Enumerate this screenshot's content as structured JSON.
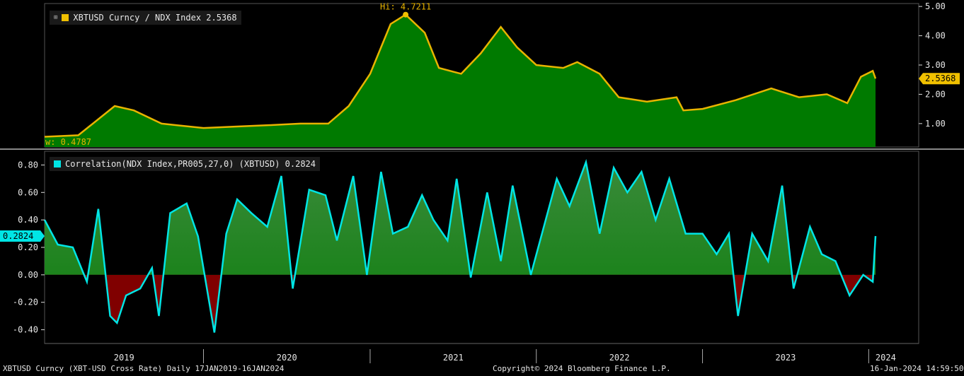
{
  "chart_data": [
    {
      "type": "area",
      "legend": "XBTUSD Curncy / NDX Index 2.5368",
      "last_value": "2.5368",
      "high_label": "Hi: 4.7211",
      "low_label": "w: 0.4787",
      "high": 4.7211,
      "low": 0.4787,
      "ylim": [
        0.2,
        5.1
      ],
      "yticks": [
        1.0,
        2.0,
        3.0,
        4.0,
        5.0
      ],
      "ytick_labels": [
        "1.00",
        "2.00",
        "3.00",
        "4.00",
        "5.00"
      ],
      "colors": {
        "line": "#e8b400",
        "fill": "#007a00",
        "tag": "#f0c000"
      },
      "x": [
        "2019-01-17",
        "2019-04-01",
        "2019-06-20",
        "2019-08-01",
        "2019-10-01",
        "2020-01-01",
        "2020-03-15",
        "2020-06-01",
        "2020-08-01",
        "2020-10-01",
        "2020-11-15",
        "2021-01-01",
        "2021-02-15",
        "2021-03-20",
        "2021-05-01",
        "2021-06-01",
        "2021-07-20",
        "2021-09-01",
        "2021-10-15",
        "2021-11-20",
        "2022-01-01",
        "2022-03-01",
        "2022-04-01",
        "2022-05-20",
        "2022-07-01",
        "2022-09-01",
        "2022-11-05",
        "2022-11-20",
        "2023-01-01",
        "2023-03-15",
        "2023-06-01",
        "2023-08-01",
        "2023-10-01",
        "2023-11-15",
        "2023-12-15",
        "2024-01-10",
        "2024-01-16"
      ],
      "values": [
        0.55,
        0.6,
        1.6,
        1.45,
        1.0,
        0.85,
        0.9,
        0.95,
        1.0,
        1.0,
        1.6,
        2.7,
        4.4,
        4.72,
        4.1,
        2.9,
        2.7,
        3.4,
        4.3,
        3.6,
        3.0,
        2.9,
        3.1,
        2.7,
        1.9,
        1.75,
        1.9,
        1.45,
        1.5,
        1.8,
        2.2,
        1.9,
        2.0,
        1.7,
        2.6,
        2.8,
        2.5368
      ]
    },
    {
      "type": "area",
      "legend": "Correlation(NDX Index,PR005,27,0) (XBTUSD) 0.2824",
      "last_value": "0.2824",
      "ylim": [
        -0.5,
        0.9
      ],
      "yticks": [
        -0.4,
        -0.2,
        0.0,
        0.2,
        0.4,
        0.6,
        0.8
      ],
      "ytick_labels": [
        "-0.40",
        "-0.20",
        "0.00",
        "0.20",
        "0.40",
        "0.60",
        "0.80"
      ],
      "colors": {
        "line": "#00e5e5",
        "pos_fill": "#0d7f0d",
        "neg_fill": "#800000",
        "tag": "#00e5e5"
      },
      "x": [
        "2019-01-17",
        "2019-02-15",
        "2019-03-20",
        "2019-04-20",
        "2019-05-15",
        "2019-06-10",
        "2019-06-25",
        "2019-07-15",
        "2019-08-15",
        "2019-09-10",
        "2019-09-25",
        "2019-10-20",
        "2019-11-25",
        "2019-12-20",
        "2020-01-25",
        "2020-02-20",
        "2020-03-15",
        "2020-04-15",
        "2020-05-20",
        "2020-06-20",
        "2020-07-15",
        "2020-08-20",
        "2020-09-25",
        "2020-10-20",
        "2020-11-25",
        "2020-12-25",
        "2021-01-25",
        "2021-02-20",
        "2021-03-25",
        "2021-04-25",
        "2021-05-20",
        "2021-06-20",
        "2021-07-10",
        "2021-08-10",
        "2021-09-15",
        "2021-10-15",
        "2021-11-10",
        "2021-12-20",
        "2022-02-15",
        "2022-03-15",
        "2022-04-20",
        "2022-05-20",
        "2022-06-20",
        "2022-07-20",
        "2022-08-20",
        "2022-09-20",
        "2022-10-20",
        "2022-11-25",
        "2023-01-01",
        "2023-02-01",
        "2023-02-28",
        "2023-03-20",
        "2023-04-20",
        "2023-05-25",
        "2023-06-25",
        "2023-07-20",
        "2023-08-25",
        "2023-09-20",
        "2023-10-20",
        "2023-11-20",
        "2023-12-20",
        "2024-01-10",
        "2024-01-16"
      ],
      "values": [
        0.4,
        0.22,
        0.2,
        -0.05,
        0.48,
        -0.3,
        -0.35,
        -0.15,
        -0.1,
        0.05,
        -0.3,
        0.45,
        0.52,
        0.28,
        -0.42,
        0.3,
        0.55,
        0.45,
        0.35,
        0.72,
        -0.1,
        0.62,
        0.58,
        0.25,
        0.72,
        0.0,
        0.75,
        0.3,
        0.35,
        0.58,
        0.4,
        0.25,
        0.7,
        -0.02,
        0.6,
        0.1,
        0.65,
        0.0,
        0.7,
        0.5,
        0.82,
        0.3,
        0.78,
        0.6,
        0.75,
        0.4,
        0.7,
        0.3,
        0.3,
        0.15,
        0.3,
        -0.3,
        0.3,
        0.1,
        0.65,
        -0.1,
        0.35,
        0.15,
        0.1,
        -0.15,
        0.0,
        -0.05,
        0.2824
      ]
    }
  ],
  "x_axis": {
    "years": [
      "2019",
      "2020",
      "2021",
      "2022",
      "2023",
      "2024"
    ]
  },
  "footer": {
    "left": "XBTUSD Curncy (XBT-USD Cross Rate)  Daily 17JAN2019-16JAN2024",
    "center": "Copyright© 2024 Bloomberg Finance L.P.",
    "right": "16-Jan-2024 14:59:50"
  }
}
